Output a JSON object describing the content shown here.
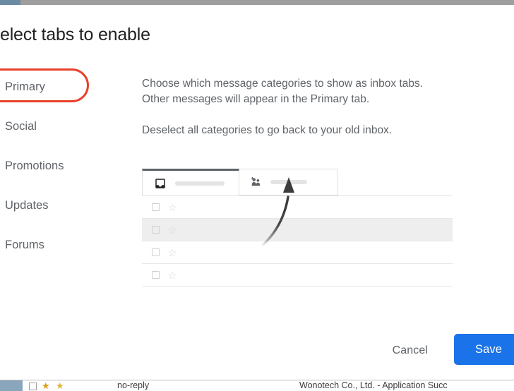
{
  "window": {
    "top_strip_color": "#9e9e9e",
    "top_strip_accent_color": "#6b8ba3"
  },
  "dialog": {
    "title": "elect tabs to enable",
    "title_full": "Select tabs to enable",
    "categories": [
      {
        "label": "Primary",
        "checked": true,
        "hover": false,
        "highlighted": true
      },
      {
        "label": "Social",
        "checked": false,
        "hover": true,
        "highlighted": false
      },
      {
        "label": "Promotions",
        "checked": false,
        "hover": false,
        "highlighted": false
      },
      {
        "label": "Updates",
        "checked": false,
        "hover": false,
        "highlighted": false
      },
      {
        "label": "Forums",
        "checked": false,
        "hover": false,
        "highlighted": false
      }
    ],
    "description": {
      "paragraph_1": "Choose which message categories to show as inbox tabs. Other messages will appear in the Primary tab.",
      "paragraph_2": "Deselect all categories to go back to your old inbox."
    },
    "preview": {
      "tabs": [
        {
          "icon": "inbox-icon",
          "active": true
        },
        {
          "icon": "people-icon",
          "active": false
        }
      ],
      "rows": [
        {
          "highlight": false
        },
        {
          "highlight": true
        },
        {
          "highlight": false
        },
        {
          "highlight": false
        }
      ]
    },
    "annotation": {
      "highlight_color": "#e8402a",
      "arrow_color": "#5f5f5f"
    },
    "actions": {
      "cancel_label": "Cancel",
      "save_label": "Save",
      "save_color": "#1a73e8"
    }
  },
  "background": {
    "email_row": {
      "sender": "no-reply",
      "subject": "Wonotech Co., Ltd. - Application Succ"
    }
  }
}
